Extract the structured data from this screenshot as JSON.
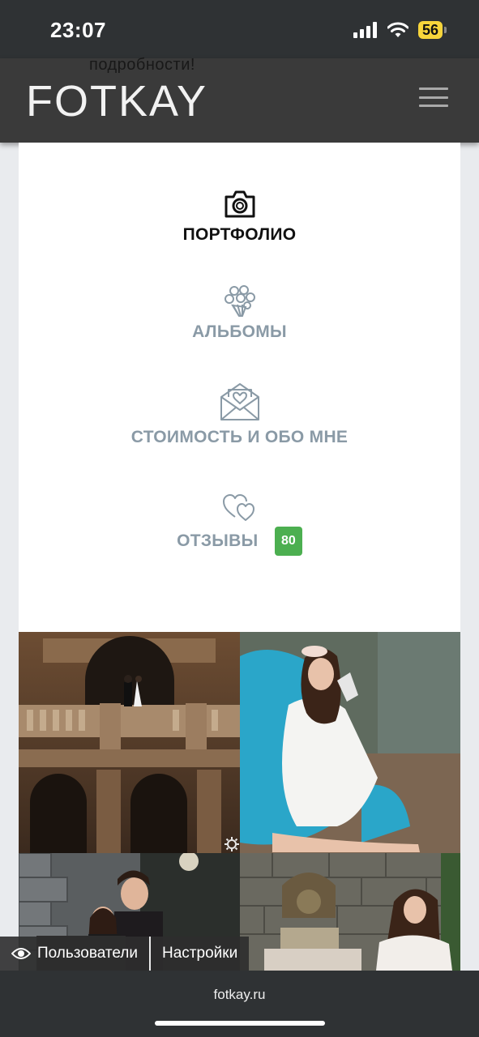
{
  "status": {
    "time": "23:07",
    "battery": "56"
  },
  "header": {
    "behind_text": "подробности!",
    "logo": "FOTKAY"
  },
  "menu": [
    {
      "label": "ПОРТФОЛИО",
      "icon": "camera-icon",
      "active": true
    },
    {
      "label": "АЛЬБОМЫ",
      "icon": "bouquet-icon",
      "active": false
    },
    {
      "label": "СТОИМОСТЬ И ОБО МНЕ",
      "icon": "heart-envelope-icon",
      "active": false
    },
    {
      "label": "ОТЗЫВЫ",
      "icon": "hearts-icon",
      "active": false,
      "badge": "80"
    }
  ],
  "photos": [
    {
      "subject": "wedding couple on palace balcony"
    },
    {
      "subject": "woman in white shirt with champagne on blue chair"
    },
    {
      "subject": "couple by stone wall"
    },
    {
      "subject": "woman in lace by lion fountain"
    }
  ],
  "footer_tabs": {
    "users": "Пользователи",
    "settings": "Настройки"
  },
  "browser": {
    "url": "fotkay.ru"
  },
  "colors": {
    "badge": "#4caf50",
    "menu_inactive": "#8a9aa6",
    "header_bg": "#3a3a3a"
  }
}
